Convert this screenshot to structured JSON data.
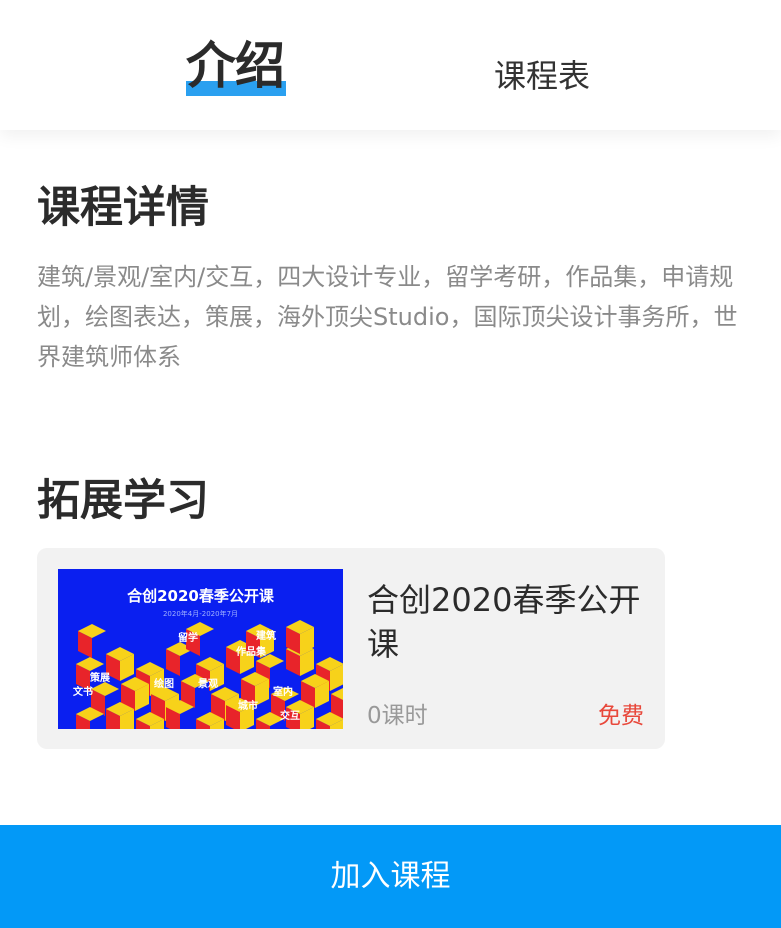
{
  "tabs": {
    "intro_label": "介绍",
    "schedule_label": "课程表",
    "active": "intro",
    "accent": "#2aa0f0"
  },
  "details": {
    "title": "课程详情",
    "description": "建筑/景观/室内/交互，四大设计专业，留学考研，作品集，申请规划，绘图表达，策展，海外顶尖Studio，国际顶尖设计事务所，世界建筑师体系"
  },
  "more": {
    "title": "拓展学习",
    "course": {
      "title": "合创2020春季公开课",
      "hours": "0课时",
      "price": "免费",
      "price_color": "#e8483b",
      "thumbnail": {
        "title": "合创2020春季公开课",
        "subtitle": "2020年4月-2020年7月",
        "labels": [
          "留学",
          "作品集",
          "建筑",
          "景观",
          "城市",
          "室内",
          "交互",
          "文书",
          "策展",
          "绘图"
        ],
        "colors": {
          "background": "#0a1ff0",
          "cube_top": "#f7d21a",
          "cube_side": "#e8242a"
        }
      }
    }
  },
  "actions": {
    "join_label": "加入课程",
    "join_color": "#0399f7"
  }
}
